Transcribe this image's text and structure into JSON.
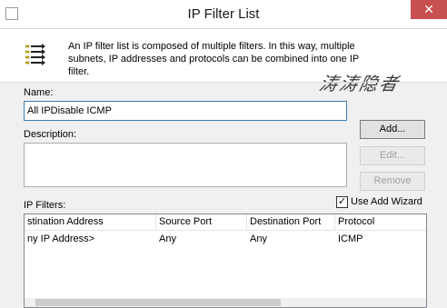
{
  "window": {
    "title": "IP Filter List",
    "close_glyph": "✕",
    "close_color": "#c75050"
  },
  "intro": {
    "icon": "filter-list-icon",
    "text": "An IP filter list is composed of multiple filters. In this way, multiple subnets, IP addresses and protocols can be combined into one IP filter."
  },
  "watermark": "涛涛隐者",
  "form": {
    "name_label": "Name:",
    "name_value": "All IPDisable ICMP",
    "description_label": "Description:",
    "description_value": ""
  },
  "buttons": {
    "add": "Add...",
    "edit": "Edit...",
    "remove": "Remove"
  },
  "filters": {
    "label": "IP Filters:",
    "use_wizard_label": "Use Add Wizard",
    "use_wizard_checked": true,
    "columns": [
      "stination Address",
      "Source Port",
      "Destination Port",
      "Protocol"
    ],
    "rows": [
      [
        "ny IP Address>",
        "Any",
        "Any",
        "ICMP"
      ]
    ]
  }
}
